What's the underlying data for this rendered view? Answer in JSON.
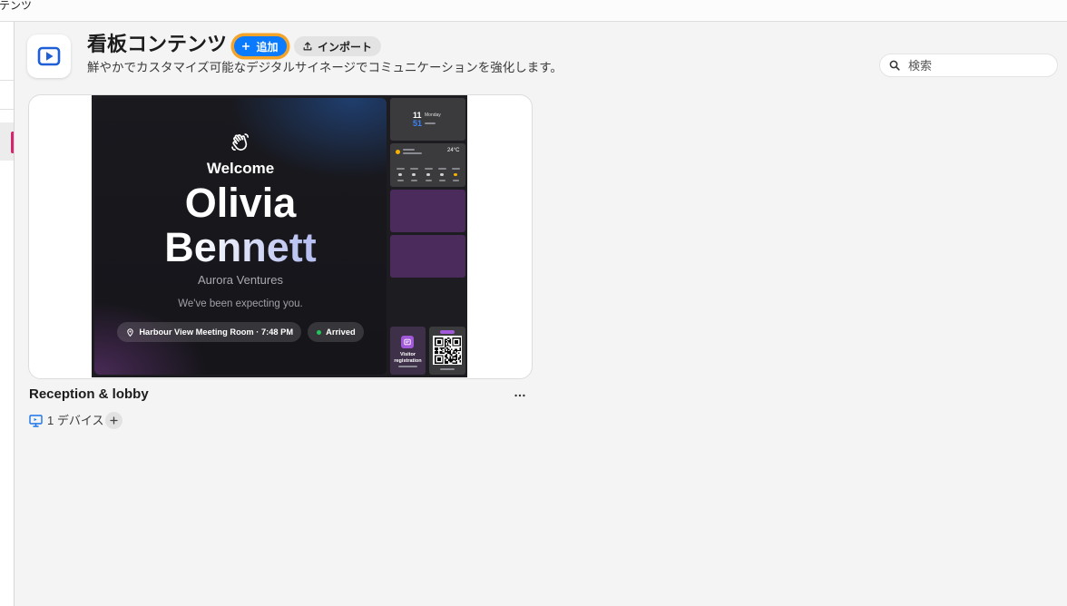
{
  "window": {
    "title_fragment": "テンツ"
  },
  "colors": {
    "accent": "#0a7aff",
    "focus_ring": "#f5a42a",
    "sidebar_active": "#d6246e",
    "brand_icon": "#1f5fd6",
    "device_icon": "#1a73e8",
    "status_arrived": "#22c55e",
    "clock_minute": "#3b82f6",
    "tile_purple": "#4b2a5c"
  },
  "header": {
    "icon": "play-icon",
    "title": "看板コンテンツ",
    "add_button": {
      "icon": "plus-icon",
      "label": "追加"
    },
    "import_button": {
      "icon": "upload-icon",
      "label": "インポート"
    },
    "subtitle": "鮮やかでカスタマイズ可能なデジタルサイネージでコミュニケーションを強化します。"
  },
  "search": {
    "icon": "search-icon",
    "placeholder": "検索"
  },
  "cards": [
    {
      "name": "Reception & lobby",
      "menu_icon": "more-horizontal-icon",
      "devices": {
        "icon": "monitor-icon",
        "label": "1 デバイス"
      },
      "add_device_icon": "plus-circle-icon",
      "preview": {
        "icon": "waving-hand-icon",
        "welcome": "Welcome",
        "first_name": "Olivia",
        "last_name": "Bennett",
        "company": "Aurora Ventures",
        "message": "We've been expecting you.",
        "location": {
          "icon": "map-pin-icon",
          "text": "Harbour View Meeting Room · 7:48 PM"
        },
        "status": "Arrived",
        "clock": {
          "hour": "11",
          "day": "Monday",
          "minute": "51"
        },
        "weather": {
          "icon": "sun-icon",
          "temperature": "24°C"
        },
        "visitor_widget": {
          "icon": "id-badge-icon",
          "label": "Visitor registration"
        },
        "qr_widget": {
          "icon": "qr-code-icon"
        }
      }
    }
  ]
}
